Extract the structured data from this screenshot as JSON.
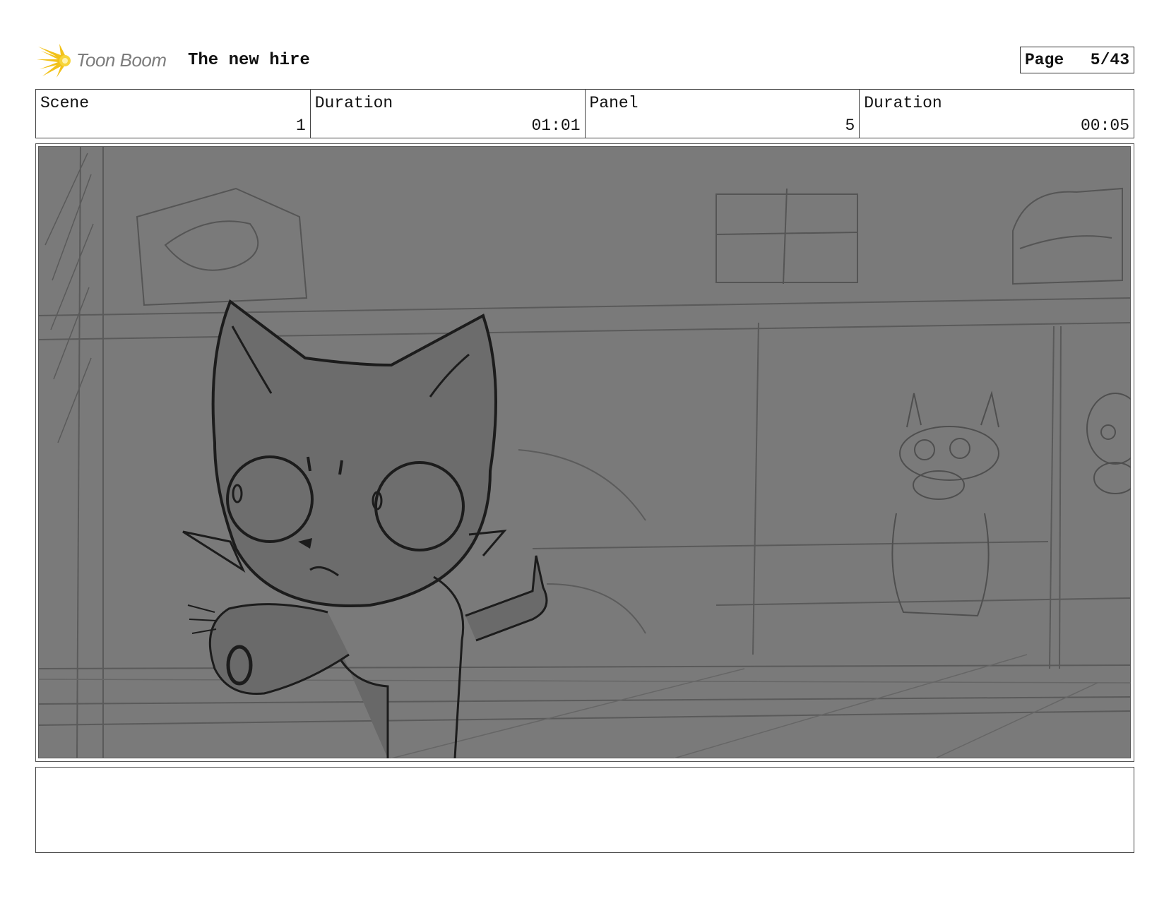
{
  "header": {
    "logo_text": "Toon Boom",
    "project_title": "The new hire",
    "page_label": "Page",
    "page_value": "5/43"
  },
  "info": {
    "scene_label": "Scene",
    "scene_value": "1",
    "scene_duration_label": "Duration",
    "scene_duration_value": "01:01",
    "panel_label": "Panel",
    "panel_value": "5",
    "panel_duration_label": "Duration",
    "panel_duration_value": "00:05"
  },
  "colors": {
    "logo_accent": "#f2c21b",
    "panel_background": "#7a7a7a",
    "sketch_lines": "#4a4a4a"
  },
  "notes": {
    "text": ""
  }
}
